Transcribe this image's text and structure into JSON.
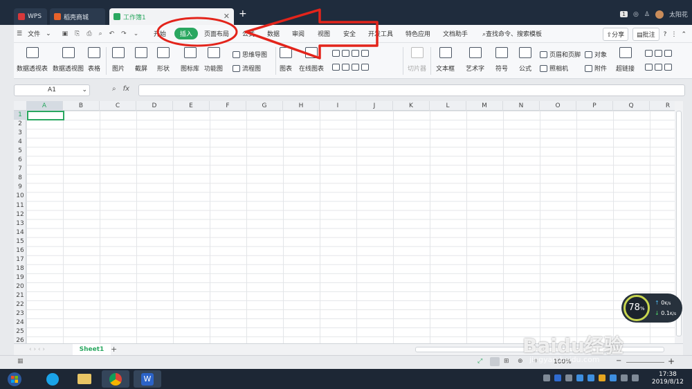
{
  "titlebar": {
    "tabs": [
      {
        "label": "WPS"
      },
      {
        "label": "稻壳商城"
      },
      {
        "label": "工作簿1"
      }
    ],
    "user_name": "太阳花",
    "badge": "1"
  },
  "menubar": {
    "file_label": "文件",
    "items": [
      "开始",
      "插入",
      "页面布局",
      "公式",
      "数据",
      "审阅",
      "视图",
      "安全",
      "开发工具",
      "特色应用",
      "文档助手"
    ],
    "active": "插入",
    "search_label": "查找命令、搜索模板",
    "share_label": "分享",
    "comment_label": "批注"
  },
  "ribbon": {
    "large": [
      "数据透视表",
      "数据透视图",
      "表格",
      "图片",
      "截屏",
      "形状",
      "图标库",
      "功能图",
      "图表",
      "在线图表",
      "切片器",
      "文本框",
      "艺术字",
      "符号",
      "公式"
    ],
    "small": [
      "思维导图",
      "流程图",
      "页眉和页脚",
      "对象",
      "照相机",
      "附件",
      "超链接"
    ]
  },
  "formula": {
    "cell_ref": "A1",
    "fx": "fx"
  },
  "grid": {
    "columns": [
      "A",
      "B",
      "C",
      "D",
      "E",
      "F",
      "G",
      "H",
      "I",
      "J",
      "K",
      "L",
      "M",
      "N",
      "O",
      "P",
      "Q",
      "R"
    ],
    "rows": [
      "1",
      "2",
      "3",
      "4",
      "5",
      "6",
      "7",
      "8",
      "9",
      "10",
      "11",
      "12",
      "13",
      "14",
      "15",
      "16",
      "17",
      "18",
      "19",
      "20",
      "21",
      "22",
      "23",
      "24",
      "25",
      "26"
    ]
  },
  "sheets": {
    "active": "Sheet1",
    "add": "+"
  },
  "status": {
    "zoom": "100%"
  },
  "speed": {
    "percent": "78",
    "up": "0",
    "down": "0.1",
    "unit": "K/s"
  },
  "taskbar": {
    "time": "17:38",
    "date": "2019/8/12"
  },
  "watermark": {
    "brand": "Baidu经验",
    "url": "jingyan.baidu.com"
  },
  "colors": {
    "accent": "#2aa760",
    "annotation": "#e3241b",
    "titlebar": "#1f2c3d"
  }
}
